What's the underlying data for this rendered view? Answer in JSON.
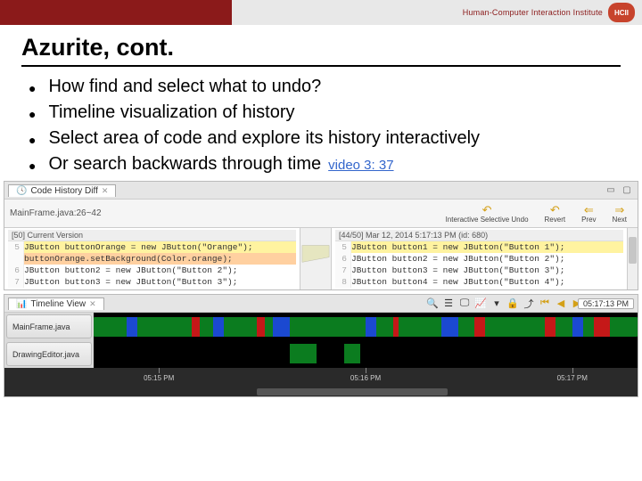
{
  "header": {
    "brand": "Human-Computer Interaction Institute",
    "logo_text": "HCII"
  },
  "slide": {
    "title": "Azurite, cont.",
    "bullets": [
      "How find and select what to undo?",
      "Timeline visualization of history",
      "Select area of code and explore its history interactively",
      "Or search backwards through time"
    ],
    "video_link": "video 3: 37"
  },
  "code_hist": {
    "tab_label": "Code History Diff",
    "file_label": "MainFrame.java:26~42",
    "left": {
      "head": "[50] Current Version",
      "lines": [
        {
          "n": "5",
          "raw": "JButton buttonOrange = new JButton(\"Orange\");",
          "hl": "y"
        },
        {
          "n": "",
          "raw": "buttonOrange.setBackground(Color.orange);",
          "hl": "o"
        },
        {
          "n": "6",
          "raw": "JButton button2 = new JButton(\"Button 2\");",
          "hl": ""
        },
        {
          "n": "7",
          "raw": "JButton button3 = new JButton(\"Button 3\");",
          "hl": ""
        }
      ]
    },
    "right": {
      "head": "[44/50] Mar 12, 2014 5:17:13 PM (id: 680)",
      "lines": [
        {
          "n": "5",
          "raw": "JButton button1 = new JButton(\"Button 1\");",
          "hl": "y"
        },
        {
          "n": "6",
          "raw": "JButton button2 = new JButton(\"Button 2\");",
          "hl": ""
        },
        {
          "n": "7",
          "raw": "JButton button3 = new JButton(\"Button 3\");",
          "hl": ""
        },
        {
          "n": "8",
          "raw": "JButton button4 = new JButton(\"Button 4\");",
          "hl": ""
        }
      ]
    },
    "toolbar": {
      "isu": "Interactive Selective Undo",
      "revert": "Revert",
      "prev": "Prev",
      "next": "Next"
    }
  },
  "timeline": {
    "tab_label": "Timeline View",
    "clock": "05:17:13 PM",
    "files": [
      "MainFrame.java",
      "DrawingEditor.java"
    ],
    "ticks": [
      "05:15 PM",
      "05:16 PM",
      "05:17 PM"
    ]
  }
}
